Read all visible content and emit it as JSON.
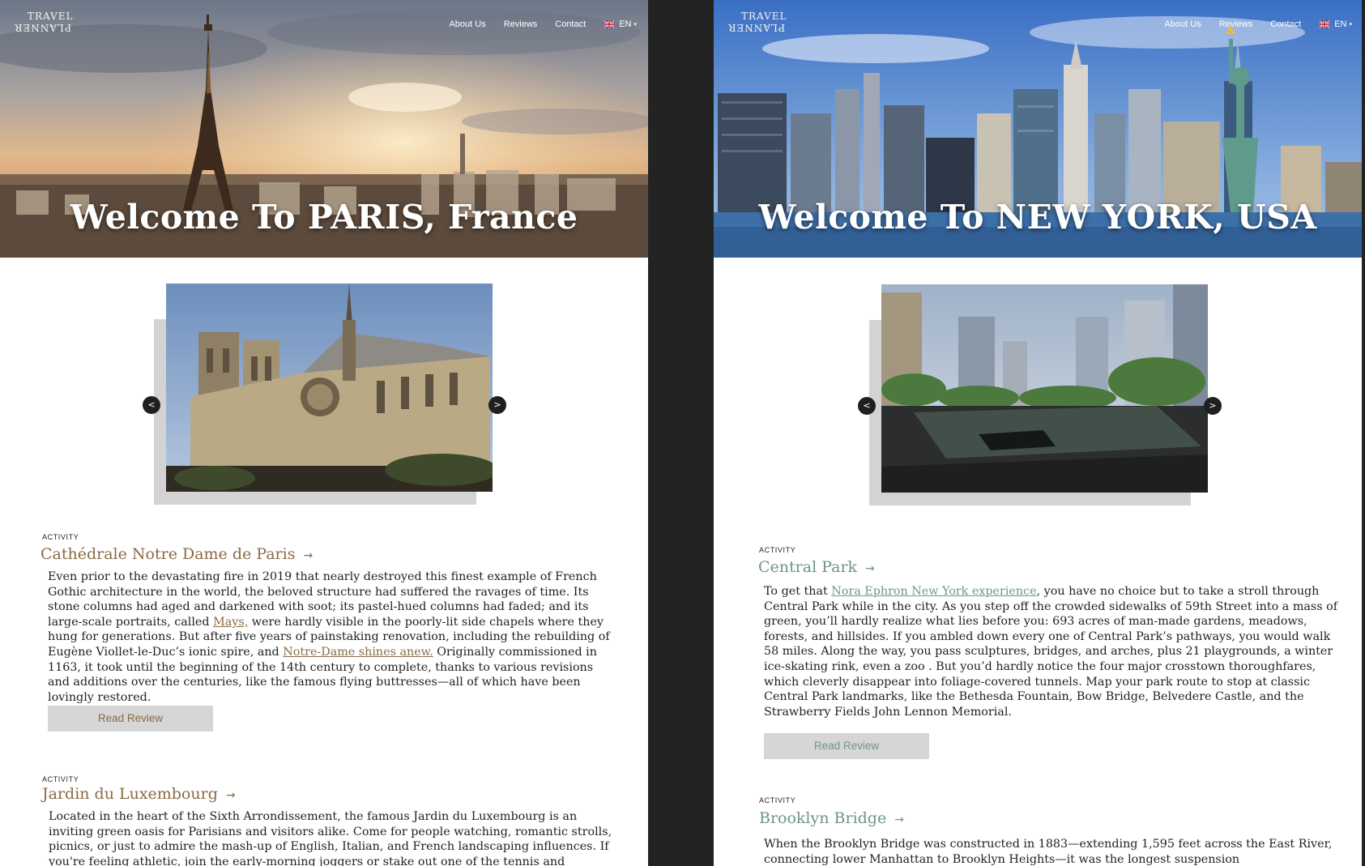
{
  "panels": {
    "paris": {
      "logo": {
        "line1": "TRAVEL",
        "line2": "PLANNER"
      },
      "nav": {
        "about": "About Us",
        "reviews": "Reviews",
        "contact": "Contact",
        "lang": "EN"
      },
      "hero_title": "Welcome To PARIS, France",
      "carousel": {
        "prev": "<",
        "next": ">"
      },
      "activities": [
        {
          "label": "ACTIVITY",
          "title": "Cathédrale Notre Dame de Paris",
          "arrow": "→",
          "text_parts": [
            "Even prior to the devastating fire in 2019 that nearly destroyed this finest example of French Gothic architecture in the world, the beloved structure had suffered the ravages of time. Its stone columns had aged and darkened with soot; its pastel-hued columns had faded; and its large-scale portraits, called ",
            "Mays,",
            " were hardly visible in the poorly-lit side chapels where they hung for generations. But after five years of painstaking renovation, including the rebuilding of Eugène Viollet-le-Duc’s ionic spire, and ",
            "Notre-Dame shines anew.",
            " Originally commissioned in 1163, it took until the beginning of the 14th century to complete, thanks to various revisions and additions over the centuries, like the famous flying buttresses—all of which have been lovingly restored."
          ],
          "button": "Read Review"
        },
        {
          "label": "ACTIVITY",
          "title": "Jardin du Luxembourg",
          "arrow": "→",
          "text": "Located in the heart of the Sixth Arrondissement, the famous Jardin du Luxembourg is an inviting green oasis for Parisians and visitors alike. Come for people watching, romantic strolls, picnics, or just to admire the mash-up of English, Italian, and French landscaping influences. If you're feeling athletic, join the early-morning joggers or stake out one of the tennis and pétanque courts."
        }
      ]
    },
    "ny": {
      "logo": {
        "line1": "TRAVEL",
        "line2": "PLANNER"
      },
      "nav": {
        "about": "About Us",
        "reviews": "Reviews",
        "contact": "Contact",
        "lang": "EN"
      },
      "hero_title": "Welcome To NEW YORK, USA",
      "carousel": {
        "prev": "<",
        "next": ">"
      },
      "activities": [
        {
          "label": "ACTIVITY",
          "title": "Central Park",
          "arrow": "→",
          "text_parts": [
            "To get that ",
            "Nora Ephron New York experience",
            ", you have no choice but to take a stroll through Central Park while in the city. As you step off the crowded sidewalks of 59th Street into a mass of green, you’ll hardly realize what lies before you: 693 acres of man-made gardens, meadows, forests, and hillsides. If you ambled down every one of Central Park’s pathways, you would walk 58 miles. Along the way, you pass sculptures, bridges, and arches, plus 21 playgrounds, a winter ice-skating rink, even a zoo . But you’d hardly notice the four major crosstown thoroughfares, which cleverly disappear into foliage-covered tunnels. Map your park route to stop at classic Central Park landmarks, like the Bethesda Fountain, Bow Bridge, Belvedere Castle, and the Strawberry Fields John Lennon Memorial."
          ],
          "button": "Read Review"
        },
        {
          "label": "ACTIVITY",
          "title": "Brooklyn Bridge",
          "arrow": "→",
          "text": "When the Brooklyn Bridge was constructed in 1883—extending 1,595 feet across the East River, connecting lower Manhattan to Brooklyn Heights—it was the longest suspension"
        }
      ]
    }
  },
  "colors": {
    "background": "#232323",
    "panel": "#ffffff",
    "paris_accent": "#8b6a45",
    "ny_accent": "#6e9683",
    "button_bg": "#d6d6d6"
  }
}
